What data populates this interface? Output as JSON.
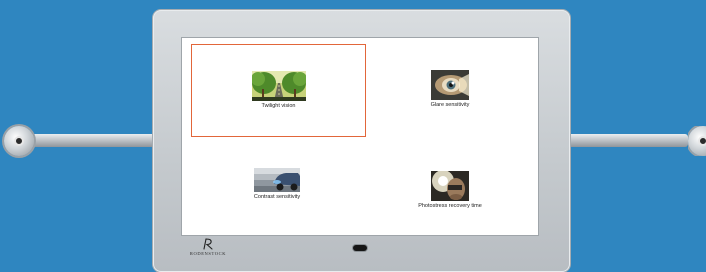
{
  "app": {
    "brand": "RODENSTOCK"
  },
  "menu": {
    "items": [
      {
        "id": "twilight",
        "label": "Twilight vision",
        "icon": "road-trees-icon",
        "selected": true
      },
      {
        "id": "glare",
        "label": "Glare sensitivity",
        "icon": "eye-glare-icon",
        "selected": false
      },
      {
        "id": "contrast",
        "label": "Contrast sensitivity",
        "icon": "car-contrast-icon",
        "selected": false
      },
      {
        "id": "photostress",
        "label": "Photostress recovery time",
        "icon": "face-bright-light-icon",
        "selected": false
      }
    ]
  },
  "colors": {
    "background": "#2f86c0",
    "selection": "#e2663a",
    "screen": "#ffffff"
  }
}
